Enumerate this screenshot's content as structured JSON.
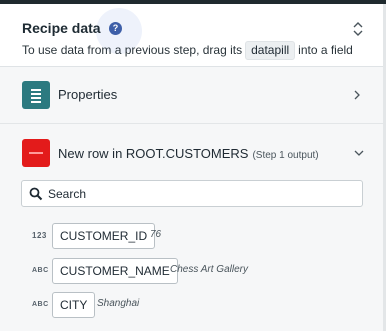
{
  "header": {
    "title": "Recipe data",
    "help_glyph": "?",
    "subtitle_before": "To use data from a previous step, drag its",
    "subtitle_pill": "datapill",
    "subtitle_after": "into a field"
  },
  "properties": {
    "label": "Properties",
    "icon": "list-icon"
  },
  "trigger": {
    "label": "New row in ROOT.CUSTOMERS",
    "step": "(Step 1 output)",
    "icon_color": "#e31b1b"
  },
  "search": {
    "placeholder": "Search",
    "value": ""
  },
  "fields": [
    {
      "type": "123",
      "name": "CUSTOMER_ID",
      "sample": "76"
    },
    {
      "type": "ABC",
      "name": "CUSTOMER_NAME",
      "sample": "Chess Art Gallery"
    },
    {
      "type": "ABC",
      "name": "CITY",
      "sample": "Shanghai"
    }
  ],
  "colors": {
    "accent_teal": "#2c7a80",
    "help_blue": "#3e5fa8",
    "panel_bg": "#f6f7f8"
  }
}
